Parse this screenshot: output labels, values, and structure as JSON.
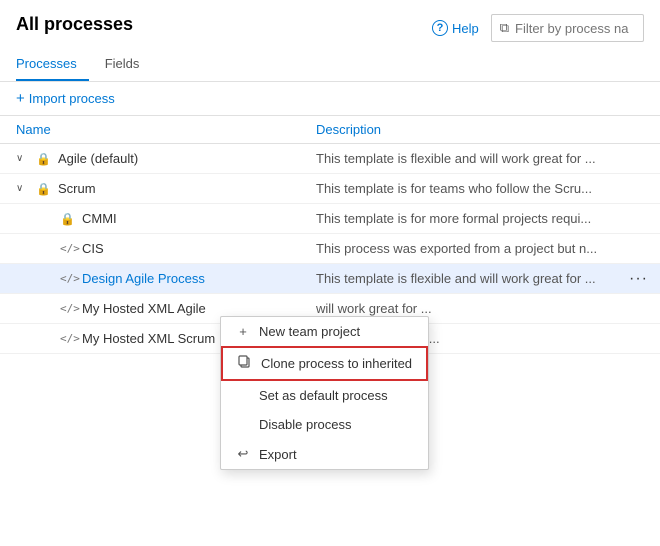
{
  "header": {
    "title": "All processes",
    "help_label": "Help",
    "filter_placeholder": "Filter by process na"
  },
  "tabs": [
    {
      "id": "processes",
      "label": "Processes",
      "active": true
    },
    {
      "id": "fields",
      "label": "Fields",
      "active": false
    }
  ],
  "toolbar": {
    "import_label": "Import process"
  },
  "table": {
    "col_name": "Name",
    "col_description": "Description",
    "rows": [
      {
        "id": "agile",
        "indent": false,
        "chevron": "∨",
        "icon": "lock",
        "name": "Agile (default)",
        "description": "This template is flexible and will work great for ...",
        "link": false
      },
      {
        "id": "scrum",
        "indent": false,
        "chevron": "∨",
        "icon": "lock",
        "name": "Scrum",
        "description": "This template is for teams who follow the Scru...",
        "link": false
      },
      {
        "id": "cmmi",
        "indent": true,
        "chevron": "",
        "icon": "lock",
        "name": "CMMI",
        "description": "This template is for more formal projects requi...",
        "link": false
      },
      {
        "id": "cis",
        "indent": true,
        "chevron": "",
        "icon": "code",
        "name": "CIS",
        "description": "This process was exported from a project but n...",
        "link": false
      },
      {
        "id": "design-agile",
        "indent": true,
        "chevron": "",
        "icon": "code",
        "name": "Design Agile Process",
        "description": "This template is flexible and will work great for ...",
        "link": true,
        "selected": true,
        "has_dots": true
      },
      {
        "id": "my-hosted-xml-agile",
        "indent": true,
        "chevron": "",
        "icon": "code",
        "name": "My Hosted XML Agile",
        "description": "will work great for ...",
        "link": false
      },
      {
        "id": "my-hosted-xml-scrum",
        "indent": true,
        "chevron": "",
        "icon": "code",
        "name": "My Hosted XML Scrum",
        "description": "who follow the Scru...",
        "link": false
      }
    ]
  },
  "context_menu": {
    "items": [
      {
        "id": "new-team-project",
        "icon": "+",
        "label": "New team project",
        "highlighted": false
      },
      {
        "id": "clone-process",
        "icon": "clone",
        "label": "Clone process to inherited",
        "highlighted": true
      },
      {
        "id": "set-default",
        "icon": "",
        "label": "Set as default process",
        "highlighted": false
      },
      {
        "id": "disable-process",
        "icon": "",
        "label": "Disable process",
        "highlighted": false
      },
      {
        "id": "export",
        "icon": "↩",
        "label": "Export",
        "highlighted": false
      }
    ]
  }
}
